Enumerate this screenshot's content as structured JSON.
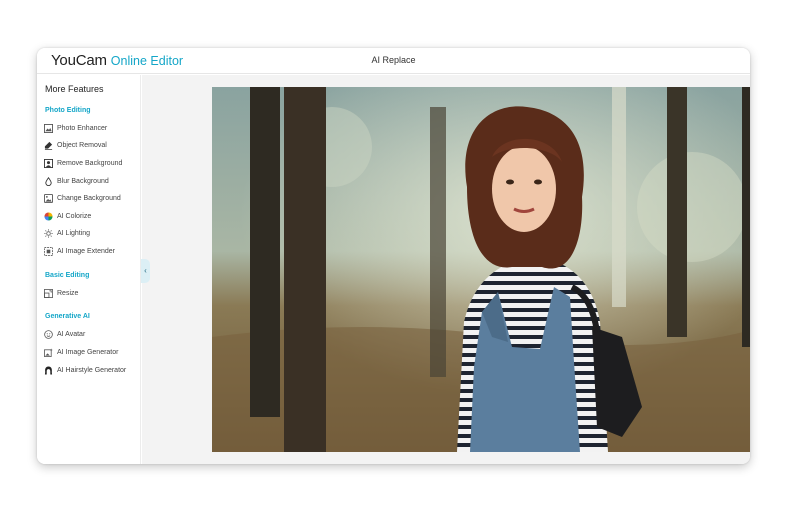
{
  "app": {
    "brand": "YouCam",
    "product": "Online Editor",
    "page_title": "AI Replace"
  },
  "sidebar": {
    "heading": "More Features",
    "sections": [
      {
        "title": "Photo Editing",
        "items": [
          {
            "label": "Photo Enhancer",
            "icon": "photo-enhancer-icon"
          },
          {
            "label": "Object Removal",
            "icon": "eraser-icon"
          },
          {
            "label": "Remove Background",
            "icon": "remove-background-icon"
          },
          {
            "label": "Blur Background",
            "icon": "drop-icon"
          },
          {
            "label": "Change Background",
            "icon": "change-background-icon"
          },
          {
            "label": "AI Colorize",
            "icon": "color-wheel-icon"
          },
          {
            "label": "AI Lighting",
            "icon": "sun-icon"
          },
          {
            "label": "AI Image Extender",
            "icon": "expand-icon"
          }
        ]
      },
      {
        "title": "Basic Editing",
        "items": [
          {
            "label": "Resize",
            "icon": "resize-icon"
          }
        ]
      },
      {
        "title": "Generative AI",
        "items": [
          {
            "label": "AI Avatar",
            "icon": "avatar-icon"
          },
          {
            "label": "AI Image Generator",
            "icon": "image-generator-icon"
          },
          {
            "label": "AI Hairstyle Generator",
            "icon": "hairstyle-icon"
          }
        ]
      }
    ]
  },
  "collapse_glyph": "‹",
  "colors": {
    "accent": "#14a6c8",
    "canvas_bg": "#f3f3f3"
  }
}
